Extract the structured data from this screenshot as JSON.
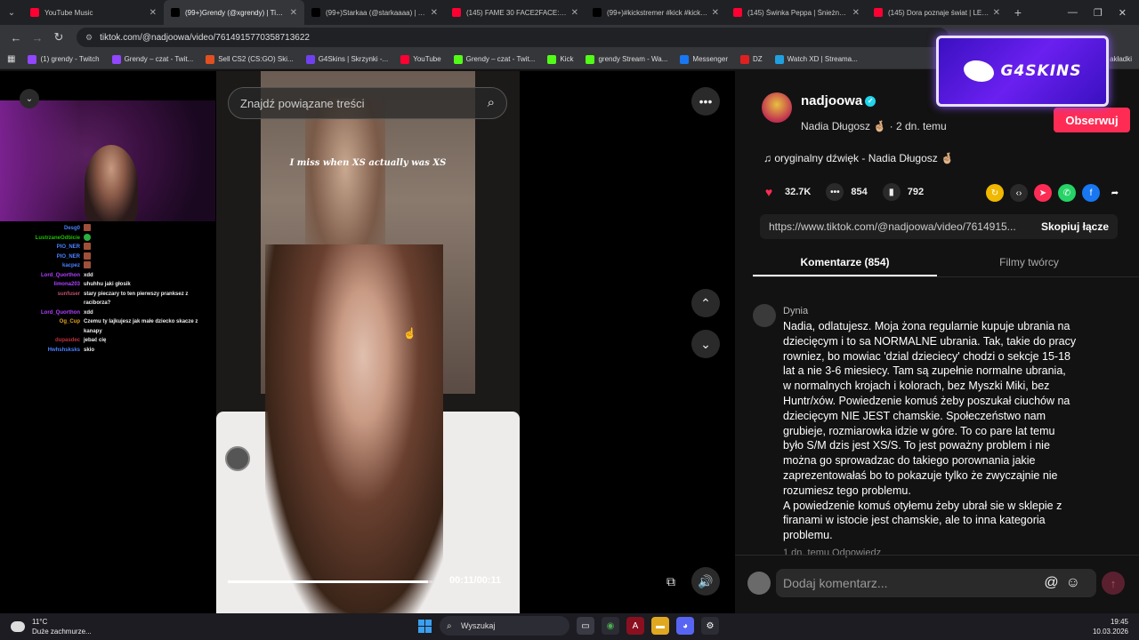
{
  "tabs": [
    {
      "label": "YouTube Music",
      "color": "#ff0033",
      "active": false
    },
    {
      "label": "(99+)Grendy (@xgrendy) | TikTok",
      "color": "#000000",
      "active": true
    },
    {
      "label": "(99+)Starkaa (@starkaaaa) | TikTok",
      "color": "#000000",
      "active": false
    },
    {
      "label": "(145) FAME 30 FACE2FACE: Wardęga",
      "color": "#ff0033",
      "active": false
    },
    {
      "label": "(99+)#kickstremer #kick #kickstre",
      "color": "#000000",
      "active": false
    },
    {
      "label": "(145) Świnka Peppa | Śnieżny dzień",
      "color": "#ff0033",
      "active": false
    },
    {
      "label": "(145) Dora poznaje świat | LETNI",
      "color": "#ff0033",
      "active": false
    }
  ],
  "address": {
    "url": "tiktok.com/@nadjoowa/video/7614915770358713622"
  },
  "bookmarks": [
    {
      "label": "(1) grendy - Twitch",
      "color": "#9146ff"
    },
    {
      "label": "Grendy – czat - Twit...",
      "color": "#9146ff"
    },
    {
      "label": "Sell CS2 (CS:GO) Ski...",
      "color": "#e05020"
    },
    {
      "label": "G4Skins | Skrzynki -...",
      "color": "#7040f0"
    },
    {
      "label": "YouTube",
      "color": "#ff0033"
    },
    {
      "label": "Grendy – czat - Twit...",
      "color": "#53fc18"
    },
    {
      "label": "Kick",
      "color": "#53fc18"
    },
    {
      "label": "grendy Stream - Wa...",
      "color": "#53fc18"
    },
    {
      "label": "Messenger",
      "color": "#1877f2"
    },
    {
      "label": "DZ",
      "color": "#e02020"
    },
    {
      "label": "Watch XD | Streama...",
      "color": "#20a0e0"
    }
  ],
  "bookmarks_right": "akładki",
  "chat": [
    {
      "user": "Desg0",
      "color": "#4a80ff",
      "msg": "",
      "emote": "brown"
    },
    {
      "user": "LustrzaneOdbicie",
      "color": "#1ec000",
      "msg": "",
      "emote": "green"
    },
    {
      "user": "PIO_NER",
      "color": "#4a80ff",
      "msg": "",
      "emote": "brown"
    },
    {
      "user": "PIO_NER",
      "color": "#4a80ff",
      "msg": "",
      "emote": "brown"
    },
    {
      "user": "kacpez",
      "color": "#4a80ff",
      "msg": "",
      "emote": "brown"
    },
    {
      "user": "Lord_Quorthon",
      "color": "#b040ff",
      "msg": "xdd",
      "emote": ""
    },
    {
      "user": "limona203",
      "color": "#b040ff",
      "msg": "uhuhhu jaki głosik",
      "emote": ""
    },
    {
      "user": "sunfuser",
      "color": "#c0506a",
      "msg": "stary pieczary to ten pierwszy pranksez z raciborza?",
      "emote": ""
    },
    {
      "user": "Lord_Quorthon",
      "color": "#b040ff",
      "msg": "xdd",
      "emote": ""
    },
    {
      "user": "Og_Cup",
      "color": "#e0a020",
      "msg": "Czemu ty lajkujesz jak małe dziecko skacze z kanapy",
      "emote": ""
    },
    {
      "user": "dupasdec",
      "color": "#c03040",
      "msg": "jebać cię",
      "emote": ""
    },
    {
      "user": "Hwhshsksks",
      "color": "#4a80ff",
      "msg": "skio",
      "emote": ""
    }
  ],
  "video": {
    "search_placeholder": "Znajdź powiązane treści",
    "caption": "I miss when XS actually was XS",
    "timecode": "00:11/00:11",
    "progress": 0.98
  },
  "author": {
    "handle": "nadjoowa",
    "name_line": "Nadia Długosz 🤞🏼 · 2 dn. temu",
    "follow_label": "Obserwuj",
    "music": "♫  oryginalny dźwięk - Nadia Długosz 🤞🏼"
  },
  "ad": {
    "text": "G4SKINS"
  },
  "stats": {
    "likes": "32.7K",
    "comments": "854",
    "saves": "792"
  },
  "link": {
    "url": "https://www.tiktok.com/@nadjoowa/video/7614915...",
    "copy_label": "Skopiuj łącze"
  },
  "panel_tabs": {
    "comments": "Komentarze (854)",
    "creator": "Filmy twórcy"
  },
  "comment": {
    "user": "Dynia",
    "text": "Nadia, odlatujesz. Moja żona regularnie kupuje ubrania na dziecięcym i to sa NORMALNE ubrania. Tak, takie do pracy rowniez, bo mowiac 'dzial dzieciecy' chodzi o sekcje 15-18 lat a nie 3-6 miesiecy. Tam są zupełnie normalne ubrania, w normalnych krojach i kolorach, bez Myszki Miki, bez Huntr/xów. Powiedzenie komuś żeby poszukał ciuchów na dziecięcym NIE JEST chamskie. Społeczeństwo nam grubieje, rozmiarowka idzie w góre. To co pare lat temu było S/M dzis jest XS/S. To jest poważny problem i nie można go sprowadzac do takiego porownania jakie zaprezentowałaś bo to pokazuje tylko że zwyczajnie nie rozumiesz tego problemu.\nA powiedzenie komuś otyłemu żeby ubrał sie w sklepie z firanami w istocie jest chamskie, ale to inna kategoria problemu.",
    "meta": "1 dn. temu   Odpowiedz"
  },
  "composer": {
    "placeholder": "Dodaj komentarz..."
  },
  "taskbar": {
    "temp": "11°C",
    "weather": "Duże zachmurze...",
    "search": "Wyszukaj",
    "time": "19:45",
    "date": "10.03.2026"
  }
}
